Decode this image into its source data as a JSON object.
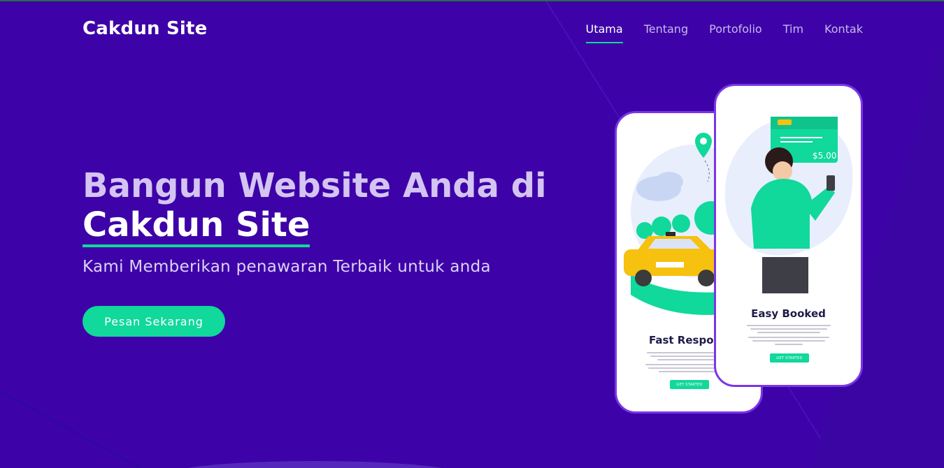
{
  "nav": {
    "brand": "Cakdun Site",
    "items": [
      {
        "label": "Utama",
        "active": true
      },
      {
        "label": "Tentang",
        "active": false
      },
      {
        "label": "Portofolio",
        "active": false
      },
      {
        "label": "Tim",
        "active": false
      },
      {
        "label": "Kontak",
        "active": false
      }
    ]
  },
  "hero": {
    "title_line1": "Bangun Website Anda di",
    "title_line2": "Cakdun Site",
    "subtitle": "Kami Memberikan penawaran Terbaik untuk anda",
    "cta_label": "Pesan Sekarang"
  },
  "phones": {
    "back": {
      "title": "Fast Respon",
      "button": "GET STARTED"
    },
    "front": {
      "title": "Easy Booked",
      "button": "GET STARTED",
      "price": "$5.00"
    }
  },
  "colors": {
    "background": "#3d03a8",
    "accent": "#11d89b",
    "phone_border": "#7a36e6"
  }
}
